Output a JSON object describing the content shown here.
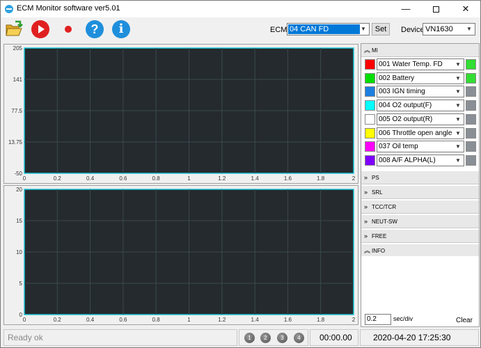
{
  "window": {
    "title": "ECM Monitor software ver5.01",
    "minimize": "—",
    "close": "✕"
  },
  "toolbar": {
    "icons": [
      "open-folder-icon",
      "play-icon",
      "record-icon",
      "help-icon",
      "info-icon"
    ],
    "help_glyph": "?",
    "info_glyph": "i",
    "ecm_label": "ECM",
    "ecm_value": "04 CAN FD",
    "set_label": "Set",
    "device_label": "Device",
    "device_value": "VN1630"
  },
  "charts": [
    {
      "y_ticks": [
        "205",
        "141",
        "77.5",
        "13.75",
        "-50"
      ],
      "x_ticks": [
        "0",
        "0.2",
        "0.4",
        "0.6",
        "0.8",
        "1",
        "1.2",
        "1.4",
        "1.6",
        "1.8",
        "2"
      ],
      "background": "#252a2e",
      "grid_color": "#3a4a4e",
      "axis_color": "#1ec8d8"
    },
    {
      "y_ticks": [
        "20",
        "15",
        "10",
        "5",
        "0"
      ],
      "x_ticks": [
        "0",
        "0.2",
        "0.4",
        "0.6",
        "0.8",
        "1",
        "1.2",
        "1.4",
        "1.6",
        "1.8",
        "2"
      ],
      "background": "#252a2e",
      "grid_color": "#3a4a4e",
      "axis_color": "#1ec8d8"
    }
  ],
  "panel": {
    "mi_header": "MI",
    "mi_items": [
      {
        "label": "001 Water Temp. FD",
        "color": "#ff0000",
        "indicator": "#33dd33"
      },
      {
        "label": "002 Battery",
        "color": "#00dd00",
        "indicator": "#33dd33"
      },
      {
        "label": "003 IGN timing",
        "color": "#1e7fe0",
        "indicator": "#8a8f96"
      },
      {
        "label": "004 O2 output(F)",
        "color": "#00ffff",
        "indicator": "#8a8f96"
      },
      {
        "label": "005 O2 output(R)",
        "color": "#ffffff",
        "indicator": "#8a8f96"
      },
      {
        "label": "006 Throttle open angle",
        "color": "#ffff00",
        "indicator": "#8a8f96"
      },
      {
        "label": "037 Oil temp",
        "color": "#ff00ff",
        "indicator": "#8a8f96"
      },
      {
        "label": "008 A/F ALPHA(L)",
        "color": "#7f00ff",
        "indicator": "#8a8f96"
      }
    ],
    "sections": [
      "PS",
      "SRL",
      "TCC/TCR",
      "NEUT-SW",
      "FREE",
      "INFO"
    ],
    "sec_div_value": "0.2",
    "sec_div_label": "sec/div",
    "clear_label": "Clear"
  },
  "status": {
    "text": "Ready ok",
    "steps": [
      "1",
      "2",
      "3",
      "4"
    ],
    "elapsed": "00:00.00",
    "datetime": "2020-04-20 17:25:30"
  }
}
